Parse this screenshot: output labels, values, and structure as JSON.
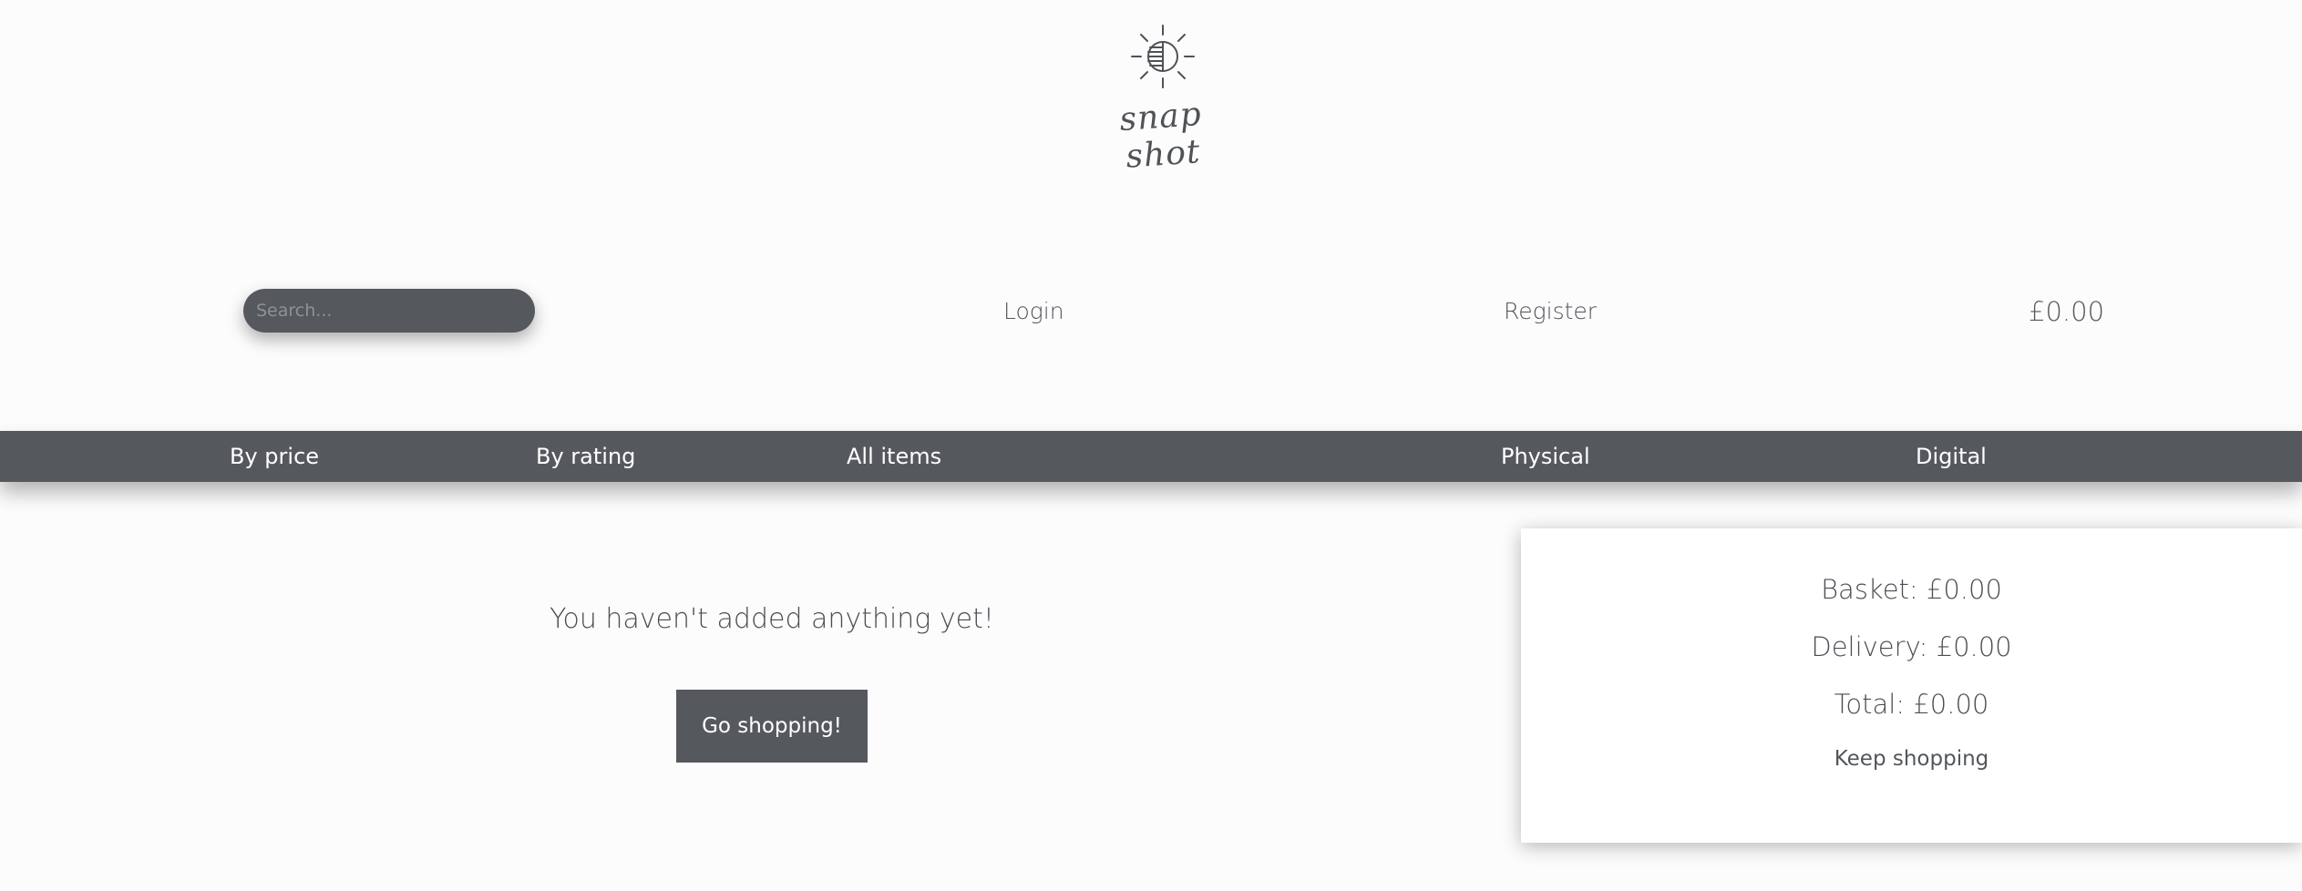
{
  "logo": {
    "text": "snap shot",
    "icon": "sun-half-circle-icon"
  },
  "header": {
    "search_placeholder": "Search...",
    "login_label": "Login",
    "register_label": "Register",
    "basket_total": "£0.00"
  },
  "nav": {
    "items": [
      {
        "label": "By price"
      },
      {
        "label": "By rating"
      },
      {
        "label": "All items"
      },
      {
        "label": "Physical"
      },
      {
        "label": "Digital"
      }
    ]
  },
  "basket": {
    "empty_message": "You haven't added anything yet!",
    "go_shopping_label": "Go shopping!"
  },
  "summary": {
    "basket_line": "Basket: £0.00",
    "delivery_line": "Delivery: £0.00",
    "total_line": "Total: £0.00",
    "keep_shopping_label": "Keep shopping"
  },
  "colors": {
    "background": "#fcfcfc",
    "accent_dark": "#55595e",
    "text": "#4a4d52"
  }
}
